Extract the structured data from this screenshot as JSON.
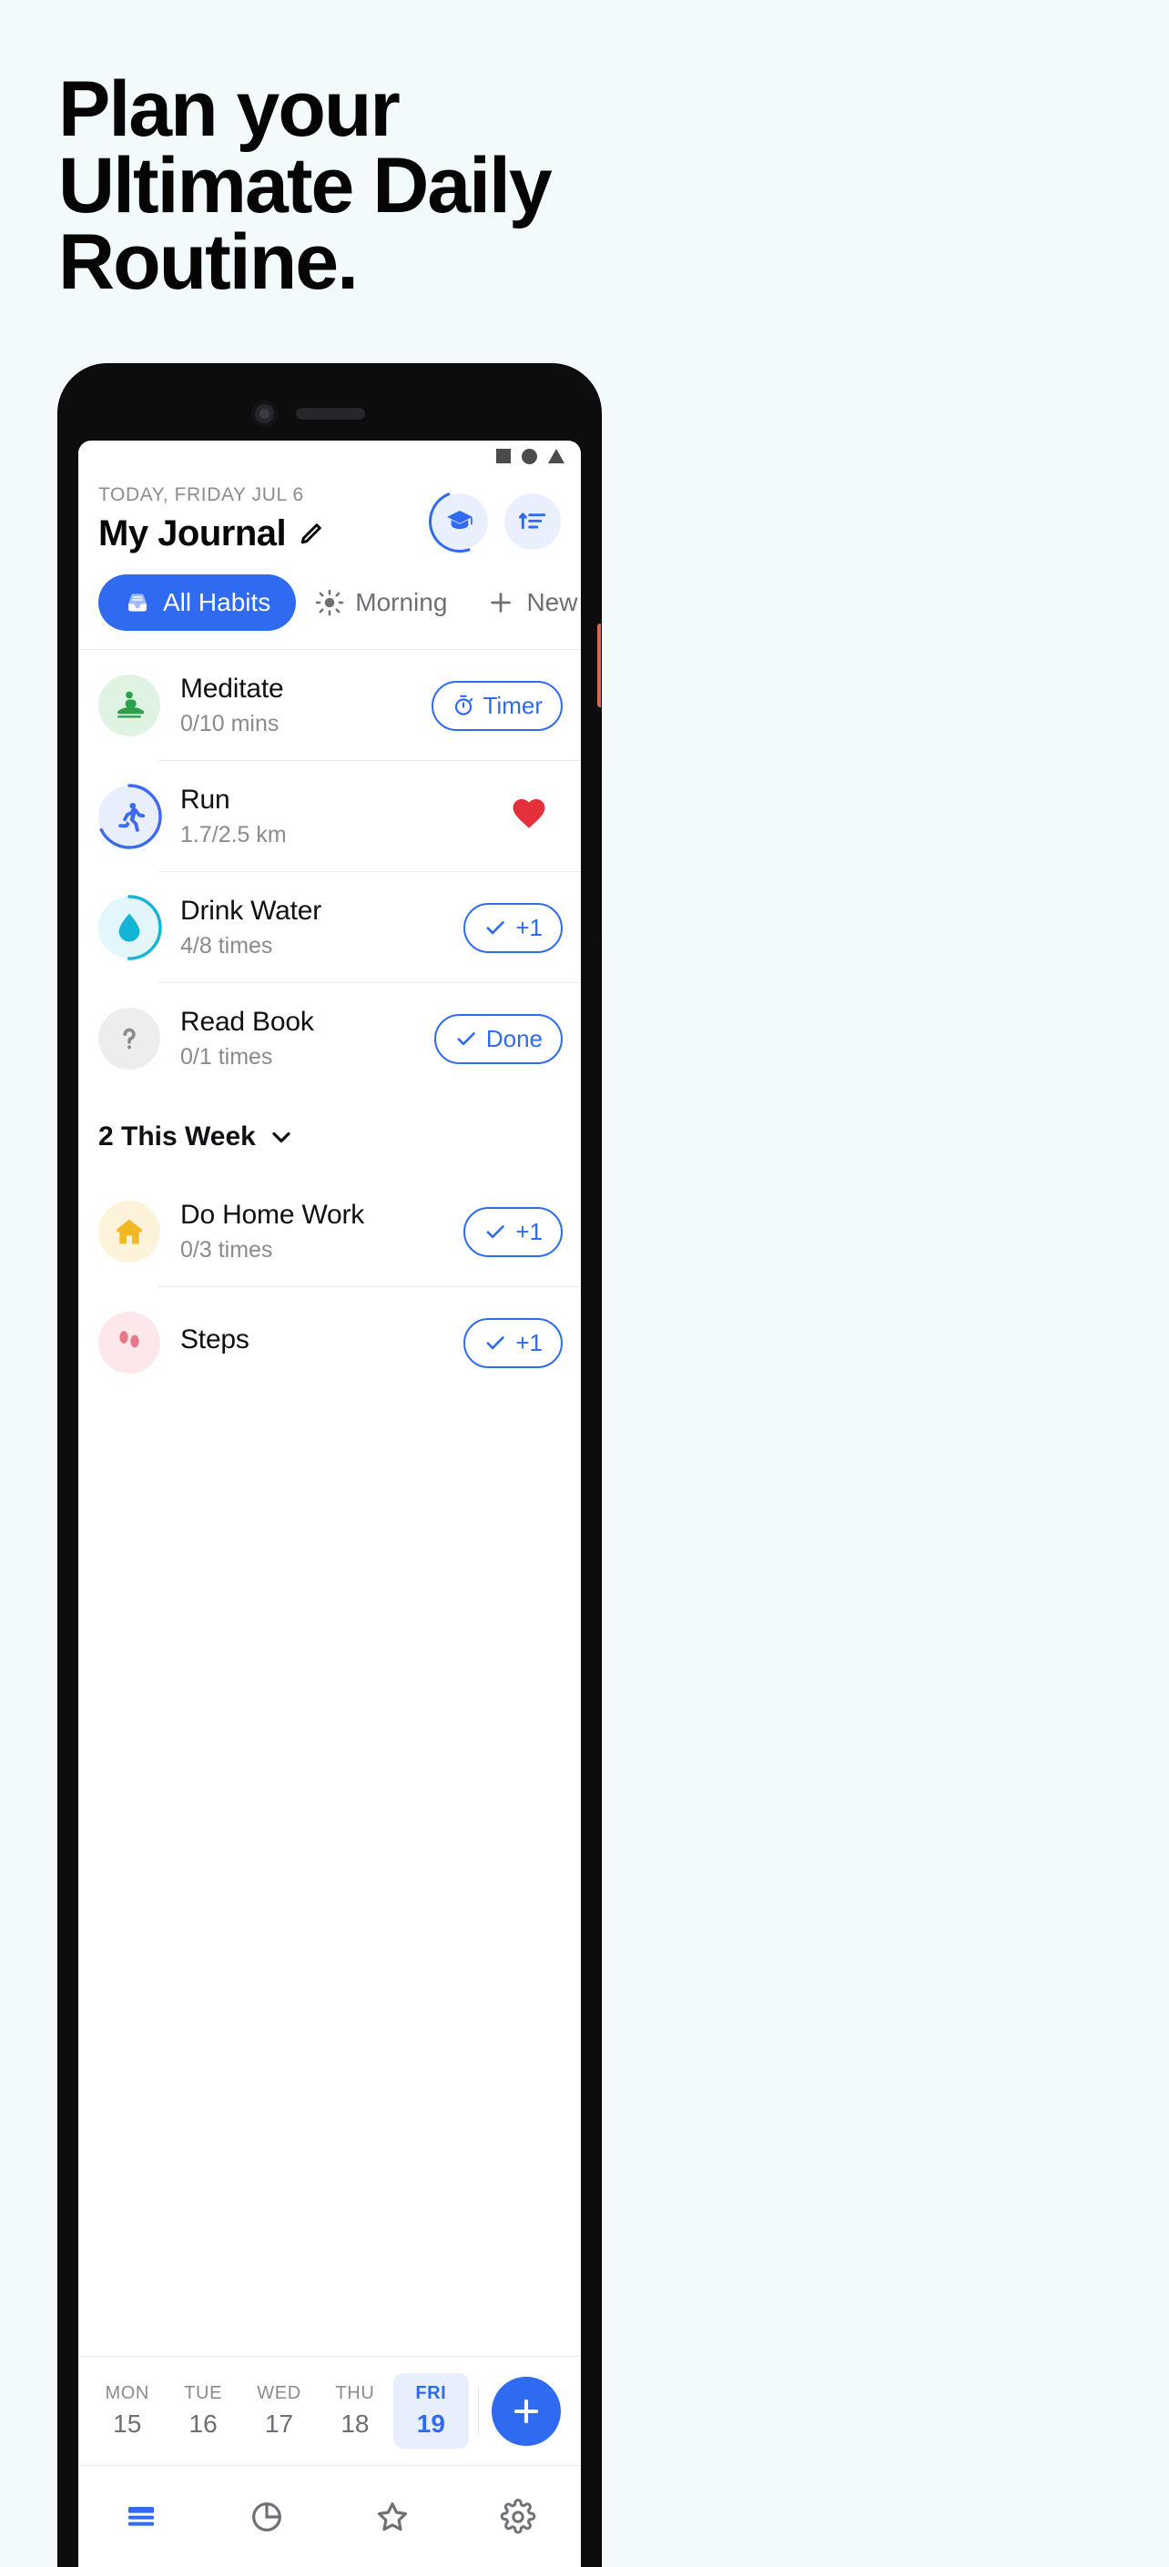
{
  "page": {
    "background_color": "#F2FAFC",
    "headline_lines": [
      "Plan your",
      "Ultimate Daily",
      "Routine."
    ]
  },
  "accent": {
    "blue": "#2F6BF0",
    "blue_light": "#E7EFFE",
    "green": "#2BA14A",
    "green_light": "#DFF3E3",
    "cyan": "#13B5D6",
    "cyan_light": "#E2F6FB",
    "yellow": "#F2B824",
    "yellow_light": "#FDF3DA",
    "gray_light": "#EDEDEF",
    "red": "#E4303A",
    "pink_light": "#FDE7EA"
  },
  "status_bar": {
    "icons": [
      "square-icon",
      "circle-icon",
      "triangle-icon"
    ]
  },
  "header": {
    "date_label": "TODAY, FRIDAY JUL 6",
    "title": "My Journal",
    "edit_icon": "pencil-icon",
    "actions": [
      {
        "name": "graduation-cap-button",
        "icon": "graduation-cap-icon"
      },
      {
        "name": "sort-button",
        "icon": "sort-ascending-icon"
      }
    ]
  },
  "tabs": [
    {
      "label": "All Habits",
      "icon": "inbox-icon",
      "active": true
    },
    {
      "label": "Morning",
      "icon": "sun-icon",
      "active": false
    },
    {
      "label": "New",
      "icon": "plus-icon",
      "active": false
    }
  ],
  "habits": [
    {
      "name": "Meditate",
      "progress": "0/10 mins",
      "icon": "meditation-icon",
      "icon_color": "#2BA14A",
      "icon_bg": "#DFF3E3",
      "ring": 0,
      "action": {
        "type": "pill",
        "label": "Timer",
        "icon": "stopwatch-icon"
      }
    },
    {
      "name": "Run",
      "progress": "1.7/2.5 km",
      "icon": "runner-icon",
      "icon_color": "#3C6BF2",
      "icon_bg": "#E9EEFC",
      "ring": 68,
      "action": {
        "type": "heart",
        "label": "",
        "icon": "heart-icon"
      }
    },
    {
      "name": "Drink Water",
      "progress": "4/8 times",
      "icon": "water-drop-icon",
      "icon_color": "#13B5D6",
      "icon_bg": "#E2F6FB",
      "ring": 50,
      "action": {
        "type": "pill",
        "label": "+1",
        "icon": "check-icon"
      }
    },
    {
      "name": "Read Book",
      "progress": "0/1 times",
      "icon": "question-mark-icon",
      "icon_color": "#8A8A90",
      "icon_bg": "#EDEDEF",
      "ring": 0,
      "action": {
        "type": "pill",
        "label": "Done",
        "icon": "check-icon"
      }
    }
  ],
  "section": {
    "label": "2 This Week",
    "chevron_icon": "chevron-down-icon"
  },
  "week_habits": [
    {
      "name": "Do Home Work",
      "progress": "0/3 times",
      "icon": "home-icon",
      "icon_color": "#F2B824",
      "icon_bg": "#FDF3DA",
      "ring": 0,
      "action": {
        "type": "pill",
        "label": "+1",
        "icon": "check-icon"
      }
    },
    {
      "name": "Steps",
      "progress": "",
      "icon": "footsteps-icon",
      "icon_color": "#E8768A",
      "icon_bg": "#FDE7EA",
      "ring": 0,
      "action": {
        "type": "pill",
        "label": "+1",
        "icon": "check-icon"
      }
    }
  ],
  "calendar": {
    "days": [
      {
        "weekday": "MON",
        "date": "15",
        "selected": false
      },
      {
        "weekday": "TUE",
        "date": "16",
        "selected": false
      },
      {
        "weekday": "WED",
        "date": "17",
        "selected": false
      },
      {
        "weekday": "THU",
        "date": "18",
        "selected": false
      },
      {
        "weekday": "FRI",
        "date": "19",
        "selected": true
      }
    ],
    "add_button_icon": "plus-icon"
  },
  "bottom_nav": [
    {
      "name": "journal",
      "icon": "list-icon",
      "active": true
    },
    {
      "name": "stats",
      "icon": "pie-chart-icon",
      "active": false
    },
    {
      "name": "challenges",
      "icon": "star-icon",
      "active": false
    },
    {
      "name": "settings",
      "icon": "gear-icon",
      "active": false
    }
  ]
}
